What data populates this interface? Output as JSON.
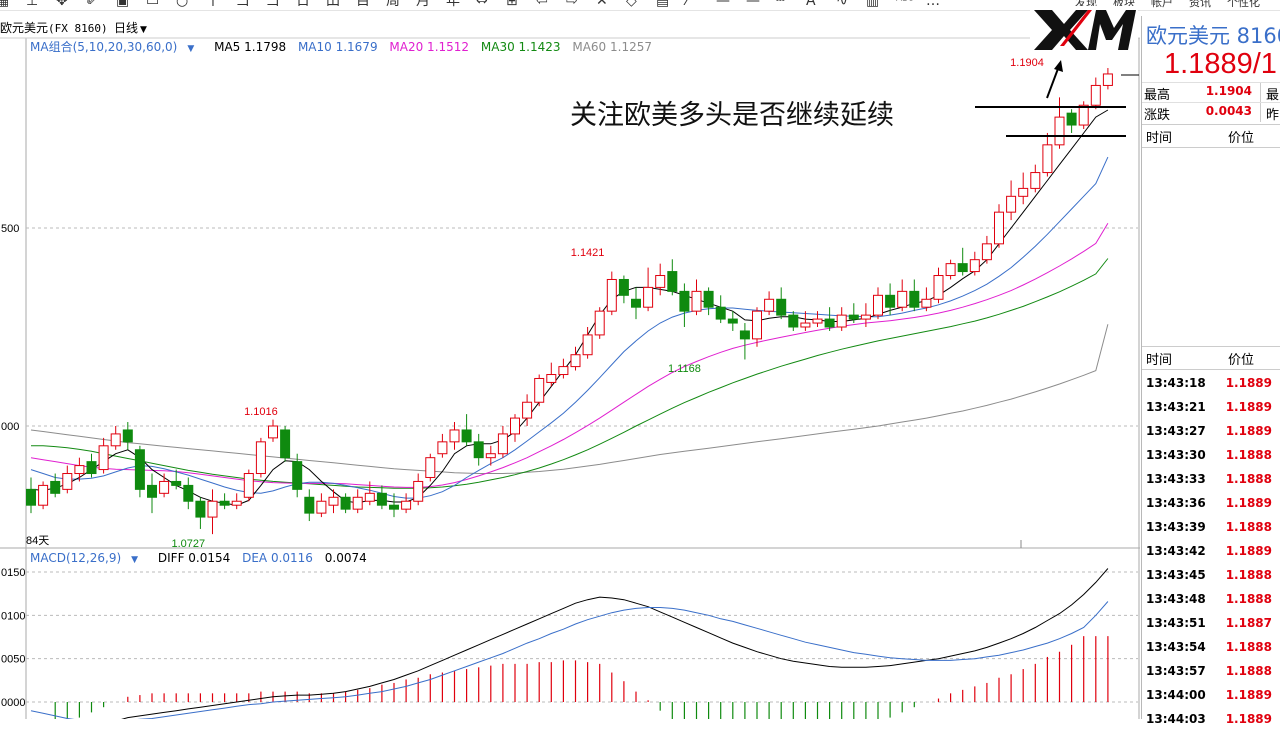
{
  "toolbar": {
    "icons": [
      "grid-icon",
      "plus-icon",
      "move-icon",
      "draw-icon",
      "rect-icon",
      "rect-outline-icon",
      "circle-icon",
      "fib-icon",
      "t1-icon",
      "t2-icon",
      "cal-icon",
      "cn-icon",
      "box-icon",
      "zhou-icon",
      "yue-icon",
      "year-icon",
      "arrows-icon",
      "cross-icon",
      "left-arrow-icon",
      "right-arrow-icon",
      "x-icon",
      "diamond-icon",
      "table-icon",
      "line-icon",
      "hline-icon",
      "hline2-icon",
      "dashline-icon",
      "text-icon",
      "wave-icon",
      "bars-icon",
      "abc-icon",
      "more-icon"
    ],
    "menu": [
      "发现",
      "板块",
      "帐户",
      "资讯",
      "个性化"
    ]
  },
  "symbol": {
    "title": "欧元美元",
    "code": "(FX 8160)",
    "period": "日线"
  },
  "ma_legend": {
    "label": "MA组合(5,10,20,30,60,0)",
    "ma5": "MA5 1.1798",
    "ma10": "MA10 1.1679",
    "ma20": "MA20 1.1512",
    "ma30": "MA30 1.1423",
    "ma60": "MA60 1.1257"
  },
  "macd_legend": {
    "label": "MACD(12,26,9)",
    "diff": "DIFF 0.0154",
    "dea": "DEA 0.0116",
    "macd": "0.0074"
  },
  "colors": {
    "up": "#e0000e",
    "down": "#0f8a0f",
    "ma5": "#000000",
    "ma10": "#3a6fc9",
    "ma20": "#e020d0",
    "ma30": "#138a13",
    "ma60": "#8c8c8c",
    "diff": "#000000",
    "dea": "#3a6fc9"
  },
  "annotation": "关注欧美多头是否继续延续",
  "logo": "XM",
  "axis": {
    "price_ticks": [
      {
        "v": 1.15,
        "label": "500"
      },
      {
        "v": 1.1,
        "label": "000"
      }
    ],
    "macd_ticks": [
      {
        "v": 0.015,
        "label": "0150"
      },
      {
        "v": 0.01,
        "label": "0100"
      },
      {
        "v": 0.005,
        "label": "0050"
      },
      {
        "v": 0.0,
        "label": "0000"
      }
    ],
    "days_label": "84天"
  },
  "labels": {
    "high1": "1.1016",
    "low1": "1.0727",
    "high2": "1.1421",
    "low2": "1.1168",
    "high3": "1.1904"
  },
  "chart_data": {
    "type": "candlestick",
    "candles": [
      [
        1.084,
        1.08,
        1.087,
        1.078
      ],
      [
        1.08,
        1.085,
        1.086,
        1.079
      ],
      [
        1.086,
        1.083,
        1.088,
        1.082
      ],
      [
        1.084,
        1.088,
        1.09,
        1.083
      ],
      [
        1.088,
        1.09,
        1.092,
        1.086
      ],
      [
        1.091,
        1.088,
        1.093,
        1.087
      ],
      [
        1.089,
        1.095,
        1.097,
        1.088
      ],
      [
        1.095,
        1.098,
        1.1,
        1.094
      ],
      [
        1.099,
        1.096,
        1.101,
        1.094
      ],
      [
        1.094,
        1.084,
        1.095,
        1.082
      ],
      [
        1.085,
        1.082,
        1.088,
        1.078
      ],
      [
        1.083,
        1.086,
        1.088,
        1.082
      ],
      [
        1.086,
        1.085,
        1.089,
        1.084
      ],
      [
        1.085,
        1.081,
        1.087,
        1.079
      ],
      [
        1.081,
        1.077,
        1.082,
        1.074
      ],
      [
        1.077,
        1.081,
        1.084,
        1.0727
      ],
      [
        1.081,
        1.08,
        1.083,
        1.079
      ],
      [
        1.08,
        1.081,
        1.083,
        1.079
      ],
      [
        1.082,
        1.088,
        1.089,
        1.081
      ],
      [
        1.088,
        1.096,
        1.097,
        1.087
      ],
      [
        1.097,
        1.1,
        1.1016,
        1.096
      ],
      [
        1.099,
        1.092,
        1.1,
        1.091
      ],
      [
        1.091,
        1.084,
        1.093,
        1.082
      ],
      [
        1.082,
        1.078,
        1.084,
        1.076
      ],
      [
        1.078,
        1.081,
        1.083,
        1.077
      ],
      [
        1.08,
        1.082,
        1.084,
        1.078
      ],
      [
        1.082,
        1.079,
        1.083,
        1.078
      ],
      [
        1.079,
        1.082,
        1.084,
        1.078
      ],
      [
        1.081,
        1.083,
        1.086,
        1.08
      ],
      [
        1.083,
        1.08,
        1.085,
        1.079
      ],
      [
        1.08,
        1.079,
        1.083,
        1.077
      ],
      [
        1.079,
        1.081,
        1.083,
        1.078
      ],
      [
        1.081,
        1.086,
        1.088,
        1.08
      ],
      [
        1.087,
        1.092,
        1.093,
        1.086
      ],
      [
        1.093,
        1.096,
        1.098,
        1.092
      ],
      [
        1.096,
        1.099,
        1.101,
        1.094
      ],
      [
        1.099,
        1.096,
        1.103,
        1.095
      ],
      [
        1.096,
        1.092,
        1.098,
        1.09
      ],
      [
        1.092,
        1.093,
        1.095,
        1.09
      ],
      [
        1.093,
        1.098,
        1.1,
        1.092
      ],
      [
        1.098,
        1.102,
        1.103,
        1.096
      ],
      [
        1.102,
        1.106,
        1.108,
        1.1
      ],
      [
        1.106,
        1.112,
        1.113,
        1.105
      ],
      [
        1.111,
        1.113,
        1.116,
        1.11
      ],
      [
        1.113,
        1.115,
        1.117,
        1.112
      ],
      [
        1.115,
        1.118,
        1.12,
        1.114
      ],
      [
        1.118,
        1.123,
        1.125,
        1.117
      ],
      [
        1.123,
        1.129,
        1.13,
        1.122
      ],
      [
        1.129,
        1.137,
        1.139,
        1.128
      ],
      [
        1.137,
        1.133,
        1.138,
        1.131
      ],
      [
        1.132,
        1.13,
        1.135,
        1.127
      ],
      [
        1.13,
        1.135,
        1.14,
        1.129
      ],
      [
        1.135,
        1.138,
        1.141,
        1.133
      ],
      [
        1.139,
        1.134,
        1.1421,
        1.133
      ],
      [
        1.134,
        1.129,
        1.136,
        1.125
      ],
      [
        1.129,
        1.134,
        1.137,
        1.128
      ],
      [
        1.134,
        1.13,
        1.135,
        1.128
      ],
      [
        1.13,
        1.127,
        1.133,
        1.126
      ],
      [
        1.127,
        1.126,
        1.129,
        1.124
      ],
      [
        1.124,
        1.122,
        1.126,
        1.1168
      ],
      [
        1.122,
        1.129,
        1.13,
        1.12
      ],
      [
        1.129,
        1.132,
        1.134,
        1.128
      ],
      [
        1.132,
        1.128,
        1.135,
        1.127
      ],
      [
        1.128,
        1.125,
        1.129,
        1.124
      ],
      [
        1.125,
        1.126,
        1.129,
        1.124
      ],
      [
        1.126,
        1.127,
        1.129,
        1.125
      ],
      [
        1.127,
        1.125,
        1.13,
        1.124
      ],
      [
        1.125,
        1.128,
        1.13,
        1.124
      ],
      [
        1.128,
        1.127,
        1.131,
        1.126
      ],
      [
        1.127,
        1.128,
        1.131,
        1.125
      ],
      [
        1.128,
        1.133,
        1.135,
        1.127
      ],
      [
        1.133,
        1.13,
        1.136,
        1.128
      ],
      [
        1.13,
        1.134,
        1.137,
        1.129
      ],
      [
        1.134,
        1.13,
        1.137,
        1.129
      ],
      [
        1.13,
        1.132,
        1.135,
        1.129
      ],
      [
        1.132,
        1.138,
        1.14,
        1.131
      ],
      [
        1.138,
        1.141,
        1.142,
        1.137
      ],
      [
        1.141,
        1.139,
        1.145,
        1.138
      ],
      [
        1.139,
        1.142,
        1.144,
        1.138
      ],
      [
        1.142,
        1.146,
        1.148,
        1.141
      ],
      [
        1.146,
        1.154,
        1.156,
        1.145
      ],
      [
        1.154,
        1.158,
        1.162,
        1.152
      ],
      [
        1.158,
        1.16,
        1.164,
        1.156
      ],
      [
        1.16,
        1.164,
        1.166,
        1.159
      ],
      [
        1.164,
        1.171,
        1.174,
        1.163
      ],
      [
        1.171,
        1.178,
        1.183,
        1.17
      ],
      [
        1.179,
        1.176,
        1.18,
        1.174
      ],
      [
        1.176,
        1.181,
        1.182,
        1.175
      ],
      [
        1.181,
        1.186,
        1.188,
        1.18
      ],
      [
        1.186,
        1.1889,
        1.1904,
        1.185
      ]
    ],
    "ma5": [
      1.084,
      1.0838,
      1.0843,
      1.0854,
      1.087,
      1.089,
      1.091,
      1.093,
      1.094,
      1.092,
      1.089,
      1.087,
      1.085,
      1.0836,
      1.082,
      1.081,
      1.0805,
      1.08,
      1.0812,
      1.085,
      1.089,
      1.0912,
      1.091,
      1.089,
      1.086,
      1.0834,
      1.081,
      1.0806,
      1.0812,
      1.0812,
      1.0808,
      1.0808,
      1.082,
      1.085,
      1.0885,
      1.093,
      1.095,
      1.0955,
      1.0955,
      1.0965,
      1.0985,
      1.102,
      1.106,
      1.11,
      1.114,
      1.118,
      1.123,
      1.128,
      1.132,
      1.134,
      1.135,
      1.135,
      1.1345,
      1.134,
      1.133,
      1.132,
      1.131,
      1.13,
      1.129,
      1.1268,
      1.1266,
      1.1272,
      1.1276,
      1.1276,
      1.127,
      1.1268,
      1.1264,
      1.1264,
      1.1268,
      1.1272,
      1.1282,
      1.1292,
      1.13,
      1.131,
      1.1316,
      1.133,
      1.135,
      1.1372,
      1.1392,
      1.142,
      1.146,
      1.15,
      1.154,
      1.158,
      1.162,
      1.166,
      1.17,
      1.174,
      1.178,
      1.1798
    ],
    "ma10": [
      1.089,
      1.088,
      1.087,
      1.0866,
      1.0866,
      1.0868,
      1.0874,
      1.0884,
      1.0894,
      1.09,
      1.0898,
      1.0892,
      1.0884,
      1.0876,
      1.0866,
      1.0856,
      1.0846,
      1.0838,
      1.0832,
      1.083,
      1.0836,
      1.0846,
      1.0854,
      1.0858,
      1.0858,
      1.0855,
      1.085,
      1.0844,
      1.0838,
      1.083,
      1.0822,
      1.0818,
      1.0818,
      1.0824,
      1.0834,
      1.085,
      1.087,
      1.0888,
      1.0905,
      1.092,
      1.094,
      1.0962,
      1.0985,
      1.1008,
      1.1032,
      1.106,
      1.109,
      1.1122,
      1.1155,
      1.1188,
      1.1215,
      1.124,
      1.126,
      1.1275,
      1.1285,
      1.1292,
      1.1296,
      1.1298,
      1.1298,
      1.1295,
      1.1292,
      1.129,
      1.1288,
      1.1286,
      1.1284,
      1.1282,
      1.128,
      1.1278,
      1.1277,
      1.1276,
      1.1276,
      1.128,
      1.1285,
      1.1292,
      1.1298,
      1.1306,
      1.1316,
      1.1328,
      1.1342,
      1.1358,
      1.1378,
      1.14,
      1.1426,
      1.1454,
      1.1484,
      1.1516,
      1.1548,
      1.158,
      1.1612,
      1.1679
    ],
    "ma20": [
      1.092,
      1.0915,
      1.091,
      1.0905,
      1.09,
      1.0896,
      1.0893,
      1.0891,
      1.089,
      1.0889,
      1.0888,
      1.0887,
      1.0885,
      1.0882,
      1.0878,
      1.0874,
      1.087,
      1.0866,
      1.0862,
      1.0859,
      1.0857,
      1.0856,
      1.0855,
      1.0855,
      1.0855,
      1.0855,
      1.0854,
      1.0852,
      1.085,
      1.0848,
      1.0846,
      1.0845,
      1.0845,
      1.0847,
      1.0851,
      1.0857,
      1.0865,
      1.0874,
      1.0884,
      1.0895,
      1.0907,
      1.092,
      1.0935,
      1.095,
      1.0966,
      1.0983,
      1.1001,
      1.102,
      1.104,
      1.106,
      1.108,
      1.11,
      1.1118,
      1.1135,
      1.115,
      1.1163,
      1.1175,
      1.1186,
      1.1196,
      1.1204,
      1.1211,
      1.1218,
      1.1224,
      1.123,
      1.1236,
      1.1242,
      1.1247,
      1.1252,
      1.1256,
      1.126,
      1.1263,
      1.1266,
      1.127,
      1.1274,
      1.1279,
      1.1285,
      1.1292,
      1.13,
      1.1309,
      1.1319,
      1.133,
      1.1342,
      1.1356,
      1.1371,
      1.1387,
      1.1404,
      1.1422,
      1.1441,
      1.1461,
      1.1512
    ],
    "ma30": [
      1.095,
      1.095,
      1.0948,
      1.0945,
      1.0941,
      1.0936,
      1.093,
      1.0924,
      1.0918,
      1.0912,
      1.0906,
      1.09,
      1.0894,
      1.0888,
      1.0883,
      1.0878,
      1.0874,
      1.087,
      1.0866,
      1.0863,
      1.086,
      1.0858,
      1.0856,
      1.0854,
      1.0852,
      1.085,
      1.0848,
      1.0846,
      1.0845,
      1.0844,
      1.0843,
      1.0843,
      1.0843,
      1.0844,
      1.0846,
      1.0849,
      1.0853,
      1.0858,
      1.0864,
      1.087,
      1.0877,
      1.0885,
      1.0894,
      1.0904,
      1.0915,
      1.0927,
      1.094,
      1.0954,
      1.0969,
      1.0984,
      1.1,
      1.1015,
      1.103,
      1.1045,
      1.1059,
      1.1072,
      1.1085,
      1.1097,
      1.1109,
      1.112,
      1.1131,
      1.1141,
      1.1151,
      1.116,
      1.1169,
      1.1178,
      1.1186,
      1.1194,
      1.1201,
      1.1208,
      1.1215,
      1.1221,
      1.1227,
      1.1233,
      1.1239,
      1.1245,
      1.1251,
      1.1258,
      1.1265,
      1.1273,
      1.1282,
      1.1292,
      1.1302,
      1.1314,
      1.1326,
      1.1339,
      1.1353,
      1.1368,
      1.1384,
      1.1423
    ],
    "ma60": [
      1.099,
      1.0986,
      1.0982,
      1.0978,
      1.0974,
      1.097,
      1.0966,
      1.0962,
      1.0958,
      1.0955,
      1.0952,
      1.0949,
      1.0946,
      1.0943,
      1.094,
      1.0937,
      1.0934,
      1.0931,
      1.0928,
      1.0925,
      1.0922,
      1.0919,
      1.0916,
      1.0913,
      1.091,
      1.0907,
      1.0904,
      1.0901,
      1.0898,
      1.0895,
      1.0892,
      1.089,
      1.0888,
      1.0886,
      1.0884,
      1.0882,
      1.0881,
      1.088,
      1.088,
      1.088,
      1.0881,
      1.0883,
      1.0885,
      1.0888,
      1.0891,
      1.0895,
      1.0899,
      1.0903,
      1.0908,
      1.0913,
      1.0918,
      1.0923,
      1.0928,
      1.0932,
      1.0936,
      1.094,
      1.0944,
      1.0948,
      1.0952,
      1.0956,
      1.096,
      1.0964,
      1.0968,
      1.0972,
      1.0976,
      1.098,
      1.0984,
      1.0988,
      1.0992,
      1.0996,
      1.1,
      1.1005,
      1.101,
      1.1015,
      1.102,
      1.1026,
      1.1032,
      1.1038,
      1.1045,
      1.1052,
      1.106,
      1.1068,
      1.1077,
      1.1086,
      1.1096,
      1.1106,
      1.1117,
      1.1128,
      1.114,
      1.1257
    ],
    "diff": [
      -0.002,
      -0.0024,
      -0.0028,
      -0.003,
      -0.003,
      -0.0028,
      -0.0025,
      -0.0022,
      -0.0018,
      -0.0016,
      -0.0014,
      -0.0012,
      -0.001,
      -0.0008,
      -0.0006,
      -0.0004,
      -0.0002,
      0.0,
      0.0002,
      0.0004,
      0.0006,
      0.0007,
      0.0008,
      0.0008,
      0.0009,
      0.001,
      0.0012,
      0.0015,
      0.0018,
      0.0022,
      0.0026,
      0.0031,
      0.0036,
      0.0042,
      0.0048,
      0.0054,
      0.006,
      0.0066,
      0.0072,
      0.0078,
      0.0084,
      0.009,
      0.0096,
      0.0102,
      0.0108,
      0.0114,
      0.0118,
      0.0121,
      0.012,
      0.0118,
      0.0114,
      0.011,
      0.0104,
      0.0098,
      0.0092,
      0.0086,
      0.008,
      0.0074,
      0.0068,
      0.0063,
      0.0058,
      0.0054,
      0.005,
      0.0047,
      0.0045,
      0.0043,
      0.0041,
      0.004,
      0.004,
      0.004,
      0.0041,
      0.0042,
      0.0044,
      0.0046,
      0.0048,
      0.005,
      0.0053,
      0.0056,
      0.0059,
      0.0063,
      0.0068,
      0.0073,
      0.0079,
      0.0086,
      0.0094,
      0.0102,
      0.0112,
      0.0124,
      0.0138,
      0.0154
    ],
    "dea": [
      -0.001,
      -0.0013,
      -0.0016,
      -0.0019,
      -0.0021,
      -0.0022,
      -0.0022,
      -0.0022,
      -0.0021,
      -0.002,
      -0.0019,
      -0.0017,
      -0.0015,
      -0.0013,
      -0.0011,
      -0.0009,
      -0.0007,
      -0.0005,
      -0.0003,
      -0.0002,
      0.0,
      0.0001,
      0.0002,
      0.0003,
      0.0004,
      0.0005,
      0.0006,
      0.0008,
      0.001,
      0.0012,
      0.0015,
      0.0018,
      0.0022,
      0.0026,
      0.0031,
      0.0036,
      0.0041,
      0.0046,
      0.0051,
      0.0056,
      0.0062,
      0.0068,
      0.0073,
      0.0079,
      0.0084,
      0.009,
      0.0095,
      0.0099,
      0.0103,
      0.0106,
      0.0108,
      0.0109,
      0.0109,
      0.0108,
      0.0106,
      0.0103,
      0.01,
      0.0096,
      0.0093,
      0.0089,
      0.0085,
      0.0081,
      0.0077,
      0.0073,
      0.0069,
      0.0066,
      0.0063,
      0.006,
      0.0057,
      0.0055,
      0.0053,
      0.0051,
      0.005,
      0.0049,
      0.0048,
      0.0048,
      0.0048,
      0.0049,
      0.005,
      0.0052,
      0.0054,
      0.0057,
      0.006,
      0.0064,
      0.0068,
      0.0073,
      0.0079,
      0.0086,
      0.01,
      0.0116
    ]
  },
  "right_panel": {
    "title": "欧元美元 8160",
    "price": "1.1889/1",
    "high_label": "最高",
    "high_value": "1.1904",
    "change_label": "涨跌",
    "change_value": "0.0043",
    "right_label_1": "最",
    "right_label_2": "昨",
    "header_time": "时间",
    "header_price": "价位",
    "ticks": [
      {
        "time": "13:43:18",
        "price": "1.1889"
      },
      {
        "time": "13:43:21",
        "price": "1.1889"
      },
      {
        "time": "13:43:27",
        "price": "1.1889"
      },
      {
        "time": "13:43:30",
        "price": "1.1888"
      },
      {
        "time": "13:43:33",
        "price": "1.1888"
      },
      {
        "time": "13:43:36",
        "price": "1.1889"
      },
      {
        "time": "13:43:39",
        "price": "1.1888"
      },
      {
        "time": "13:43:42",
        "price": "1.1889"
      },
      {
        "time": "13:43:45",
        "price": "1.1888"
      },
      {
        "time": "13:43:48",
        "price": "1.1888"
      },
      {
        "time": "13:43:51",
        "price": "1.1887"
      },
      {
        "time": "13:43:54",
        "price": "1.1888"
      },
      {
        "time": "13:43:57",
        "price": "1.1888"
      },
      {
        "time": "13:44:00",
        "price": "1.1889"
      },
      {
        "time": "13:44:03",
        "price": "1.1889"
      }
    ]
  }
}
